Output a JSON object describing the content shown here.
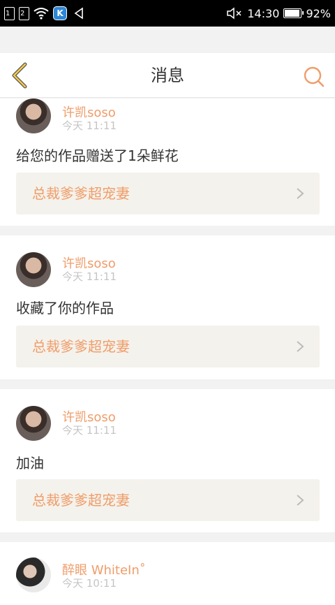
{
  "status_bar": {
    "sim1": "1",
    "sim2": "2",
    "app_badge": "K",
    "time": "14:30",
    "battery": "92%",
    "battery_level": 0.92
  },
  "header": {
    "title": "消息",
    "back_icon": "chevron-left-icon",
    "search_icon": "search-icon"
  },
  "colors": {
    "accent": "#ef9d6a",
    "back_arrow": "#f2c94c",
    "work_bg": "#f4f2ec"
  },
  "messages": [
    {
      "user": "许凯soso",
      "time": "今天 11:11",
      "text": "给您的作品赠送了1朵鲜花",
      "work_title": "总裁爹爹超宠妻"
    },
    {
      "user": "许凯soso",
      "time": "今天 11:11",
      "text": "收藏了你的作品",
      "work_title": "总裁爹爹超宠妻"
    },
    {
      "user": "许凯soso",
      "time": "今天 11:11",
      "text": "加油",
      "work_title": "总裁爹爹超宠妻"
    },
    {
      "user": "醉眼 WhiteIn˚",
      "time": "今天 10:11"
    }
  ]
}
